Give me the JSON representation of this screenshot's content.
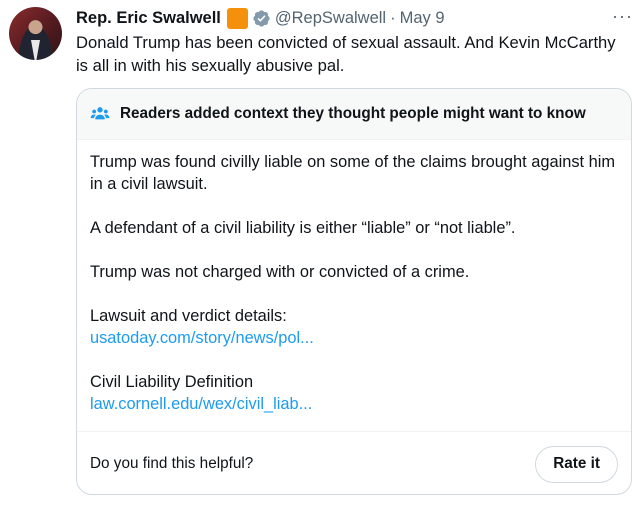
{
  "tweet": {
    "author_name": "Rep. Eric Swalwell",
    "handle": "@RepSwalwell",
    "separator": "·",
    "date": "May 9",
    "text": "Donald Trump has been convicted of sexual assault. And Kevin McCarthy is all in with his sexually abusive pal."
  },
  "icons": {
    "flag": "orange-square-icon",
    "verified": "verified-badge-icon",
    "more": "more-options-icon",
    "people": "people-icon"
  },
  "colors": {
    "accent": "#1d9bf0",
    "flag": "#f4900c",
    "secondary_text": "#536471",
    "border": "#cfd9de"
  },
  "community_note": {
    "title": "Readers added context they thought people might want to know",
    "paragraphs": [
      "Trump was found civilly liable on some of the claims brought against him in a civil lawsuit.",
      "A defendant of a civil liability is either “liable” or “not liable”.",
      "Trump was not charged with or convicted of a crime."
    ],
    "sources": [
      {
        "label": "Lawsuit and verdict details:",
        "link": "usatoday.com/story/news/pol..."
      },
      {
        "label": "Civil Liability Definition",
        "link": "law.cornell.edu/wex/civil_liab..."
      }
    ],
    "helpful_question": "Do you find this helpful?",
    "rate_button": "Rate it"
  }
}
